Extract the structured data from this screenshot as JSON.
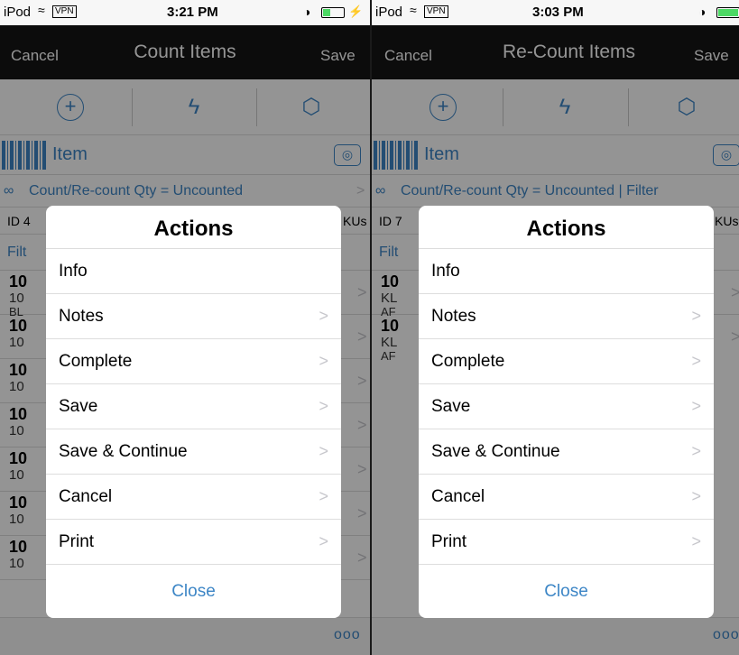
{
  "left": {
    "status": {
      "carrier": "iPod",
      "vpn": "VPN",
      "time": "3:21 PM"
    },
    "nav": {
      "cancel": "Cancel",
      "title": "Count Items",
      "save": "Save"
    },
    "item_label": "Item",
    "filter_text": "Count/Re-count Qty = Uncounted",
    "id_prefix": "ID 4",
    "id_suffix": "KUs",
    "filt_prefix": "Filt",
    "rows": [
      {
        "big": "10",
        "small": "10"
      },
      {
        "big": "10",
        "small": "10"
      },
      {
        "big": "10",
        "small": "10"
      },
      {
        "big": "10",
        "small": "10"
      },
      {
        "big": "10",
        "small": "10"
      },
      {
        "big": "10",
        "small": "10"
      },
      {
        "big": "10",
        "small": "10"
      }
    ],
    "row0_extra": "BL",
    "more": "ooo"
  },
  "right": {
    "status": {
      "carrier": "iPod",
      "vpn": "VPN",
      "time": "3:03 PM"
    },
    "nav": {
      "cancel": "Cancel",
      "title": "Re-Count Items",
      "save": "Save"
    },
    "item_label": "Item",
    "filter_text": "Count/Re-count Qty = Uncounted | Filter",
    "id_prefix": "ID 7",
    "id_suffix": "KUs",
    "filt_prefix": "Filt",
    "rows": [
      {
        "big": "10",
        "small": "KL",
        "extra": "AF"
      },
      {
        "big": "10",
        "small": "KL",
        "extra": "AF"
      }
    ],
    "more": "ooo"
  },
  "modal": {
    "title": "Actions",
    "items": [
      {
        "label": "Info",
        "chevron": ""
      },
      {
        "label": "Notes",
        "chevron": ">"
      },
      {
        "label": "Complete",
        "chevron": ">"
      },
      {
        "label": "Save",
        "chevron": ">"
      },
      {
        "label": "Save & Continue",
        "chevron": ">"
      },
      {
        "label": "Cancel",
        "chevron": ">"
      },
      {
        "label": "Print",
        "chevron": ">"
      }
    ],
    "close": "Close"
  },
  "colors": {
    "accent": "#3d86c6",
    "navbar": "#161616",
    "chevron": "#c7c7cc"
  },
  "icons": [
    "wifi-icon",
    "alarm-icon",
    "battery-icon",
    "plus-circle-icon",
    "bolt-icon",
    "cube-icon",
    "barcode-icon",
    "camera-icon",
    "glasses-icon",
    "chevron-right-icon"
  ]
}
